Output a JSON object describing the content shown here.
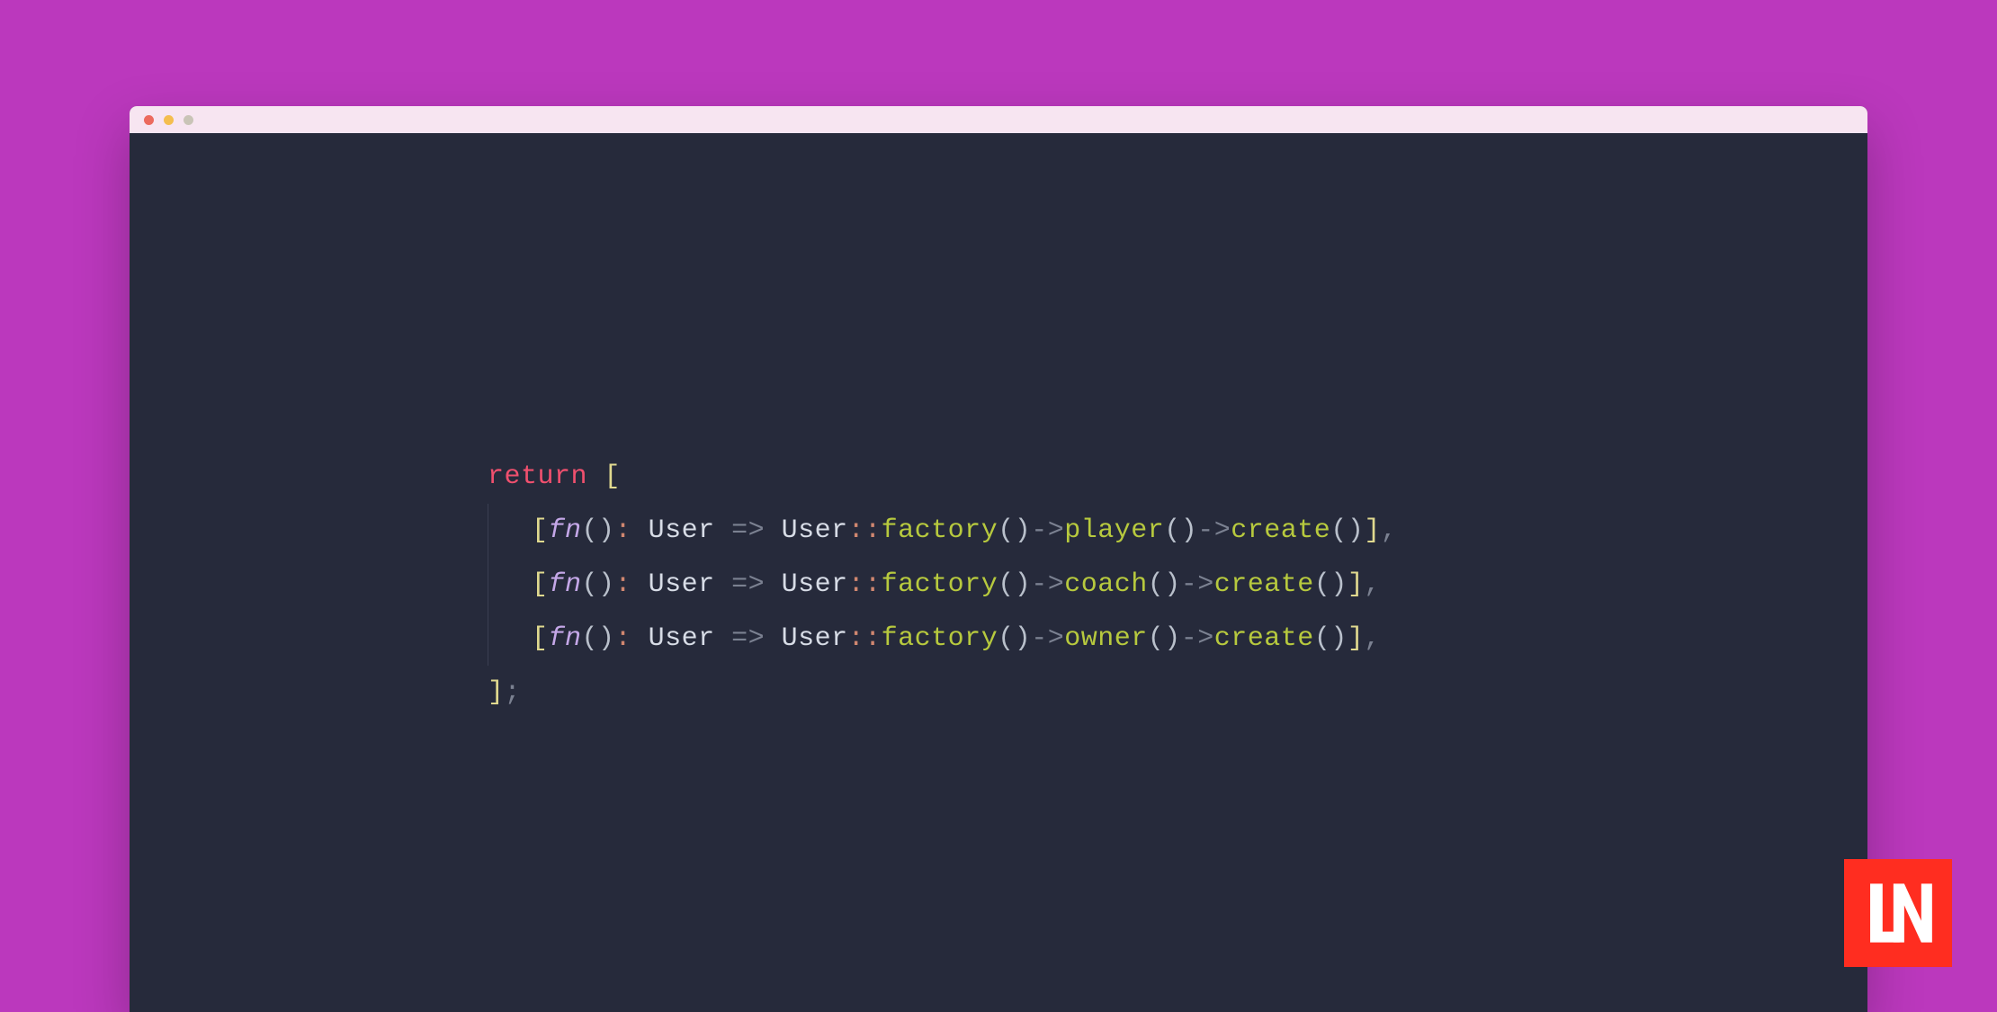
{
  "code": {
    "keyword_return": "return",
    "open_bracket": "[",
    "close_bracket": "]",
    "semicolon": ";",
    "lines": [
      {
        "fn": "fn",
        "type": "User",
        "class": "User",
        "factory": "factory",
        "method": "player",
        "create": "create"
      },
      {
        "fn": "fn",
        "type": "User",
        "class": "User",
        "factory": "factory",
        "method": "coach",
        "create": "create"
      },
      {
        "fn": "fn",
        "type": "User",
        "class": "User",
        "factory": "factory",
        "method": "owner",
        "create": "create"
      }
    ]
  },
  "logo": {
    "text": "LN"
  },
  "colors": {
    "page_bg": "#bb38bd",
    "editor_bg": "#262a3b",
    "titlebar_bg": "#f7e5f1",
    "logo_bg": "#ff2d20"
  }
}
